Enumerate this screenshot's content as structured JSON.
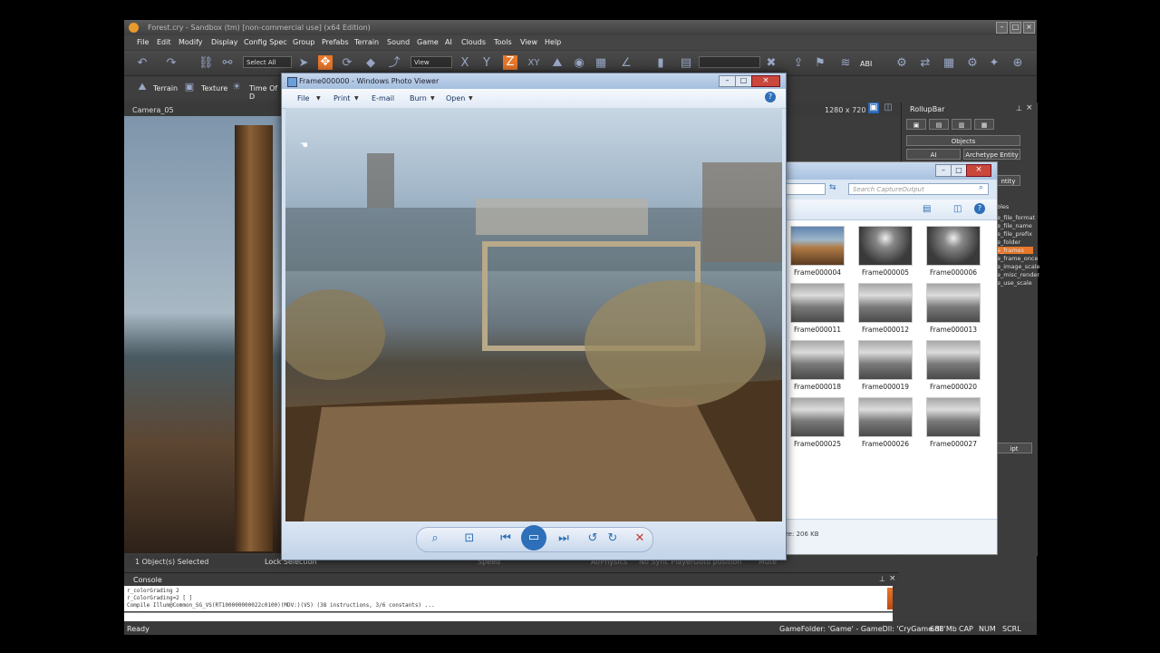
{
  "sandbox": {
    "title": "Forest.cry - Sandbox (tm) [non-commercial use] (x64 Edition)",
    "menu": [
      "File",
      "Edit",
      "Modify",
      "Display",
      "Config Spec",
      "Group",
      "Prefabs",
      "Terrain",
      "Sound",
      "Game",
      "AI",
      "Clouds",
      "Tools",
      "View",
      "Help"
    ],
    "toolbar": {
      "select_all": "Select All",
      "view": "View",
      "abi": "ABI"
    },
    "toolbar2": {
      "terrain": "Terrain",
      "texture": "Texture",
      "time_of_day": "Time Of D"
    },
    "viewport": {
      "camera": "Camera_05",
      "resolution": "1280 x 720"
    },
    "status_strip": {
      "selected": "1 Object(s) Selected",
      "lock_selection": "Lock Selection",
      "speed": "Speed",
      "ai_physics": "AI/Physics",
      "no_sync_player": "No Sync Player",
      "goto_position": "Goto position",
      "mute": "Mute"
    },
    "console": {
      "title": "Console",
      "lines": [
        "r_colorGrading 2",
        "r_ColorGrading=2 [ ]",
        "Compile Illum@Common_SG_VS(RT100000000022c0100)(MDV:)(VS) (38 instructions, 3/6 constants) ..."
      ]
    },
    "statusbar": {
      "ready": "Ready",
      "gamefolder": "GameFolder: 'Game' - GameDll: 'CryGame.dll'",
      "memory": "688 Mb",
      "cap": "CAP",
      "num": "NUM",
      "scrl": "SCRL"
    }
  },
  "rollup": {
    "title": "RollupBar",
    "objects": "Objects",
    "ai": "AI",
    "archetype_entity": "Archetype Entity",
    "entity": "ntity",
    "script": "ipt"
  },
  "sidelist": {
    "header": "bles",
    "items": [
      "e_file_format",
      "e_file_name",
      "e_file_prefix",
      "e_folder",
      "e_frames",
      "e_frame_once",
      "e_image_scale",
      "e_misc_render",
      "e_use_scale"
    ],
    "selected_index": 4
  },
  "explorer": {
    "search_placeholder": "Search CaptureOutput",
    "thumbnails": [
      [
        "Frame000004",
        "Frame000005",
        "Frame000006"
      ],
      [
        "Frame000011",
        "Frame000012",
        "Frame000013"
      ],
      [
        "Frame000018",
        "Frame000019",
        "Frame000020"
      ],
      [
        "Frame000025",
        "Frame000026",
        "Frame000027"
      ]
    ],
    "details": "ze: 206 KB"
  },
  "viewer": {
    "title": "Frame000000 - Windows Photo Viewer",
    "menu": [
      {
        "label": "File"
      },
      {
        "label": "Print"
      },
      {
        "label": "E-mail"
      },
      {
        "label": "Burn"
      },
      {
        "label": "Open"
      }
    ]
  },
  "colors": {
    "sandbox_bg": "#3c3c3c",
    "selection": "#e8772a",
    "viewer_chrome": "#c4d6ec"
  },
  "icons": [
    "undo-icon",
    "redo-icon",
    "move-icon",
    "rotate-icon",
    "scale-icon",
    "zoom-icon",
    "fit-icon",
    "prev-icon",
    "slideshow-icon",
    "next-icon",
    "rotate-ccw-icon",
    "rotate-cw-icon",
    "delete-icon",
    "help-icon",
    "search-icon"
  ]
}
